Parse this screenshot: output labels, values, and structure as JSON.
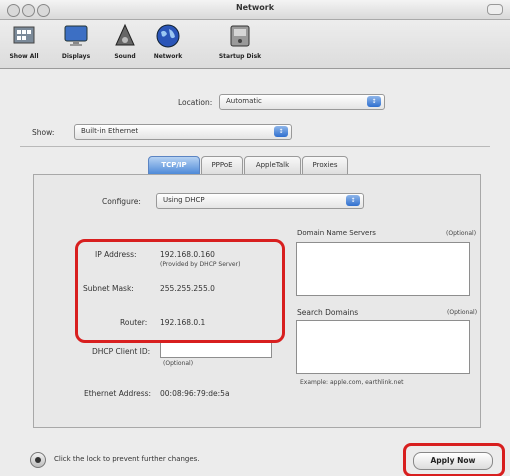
{
  "window": {
    "title": "Network"
  },
  "toolbar": [
    {
      "label": "Show All",
      "icon": "show-all-icon"
    },
    {
      "label": "Displays",
      "icon": "displays-icon"
    },
    {
      "label": "Sound",
      "icon": "sound-icon"
    },
    {
      "label": "Network",
      "icon": "network-icon"
    },
    {
      "label": "Startup Disk",
      "icon": "startup-disk-icon"
    }
  ],
  "location": {
    "label": "Location:",
    "value": "Automatic"
  },
  "show": {
    "label": "Show:",
    "value": "Built-in Ethernet"
  },
  "tabs": [
    "TCP/IP",
    "PPPoE",
    "AppleTalk",
    "Proxies"
  ],
  "configure": {
    "label": "Configure:",
    "value": "Using DHCP"
  },
  "dns": {
    "label": "Domain Name Servers",
    "optional": "(Optional)"
  },
  "ip": {
    "label": "IP Address:",
    "value": "192.168.0.160",
    "note": "(Provided by DHCP Server)"
  },
  "subnet": {
    "label": "Subnet Mask:",
    "value": "255.255.255.0"
  },
  "router": {
    "label": "Router:",
    "value": "192.168.0.1"
  },
  "search": {
    "label": "Search Domains",
    "optional": "(Optional)"
  },
  "dhcp_client": {
    "label": "DHCP Client ID:",
    "value": "",
    "optional": "(Optional)"
  },
  "example": "Example: apple.com, earthlink.net",
  "ethernet": {
    "label": "Ethernet Address:",
    "value": "00:08:96:79:de:5a"
  },
  "footer": {
    "lock_text": "Click the lock to prevent further changes.",
    "apply": "Apply Now"
  },
  "colors": {
    "highlight": "#d81f1f",
    "selected_tab": "#4e8ad8",
    "arrow": "#2f6fcf"
  }
}
